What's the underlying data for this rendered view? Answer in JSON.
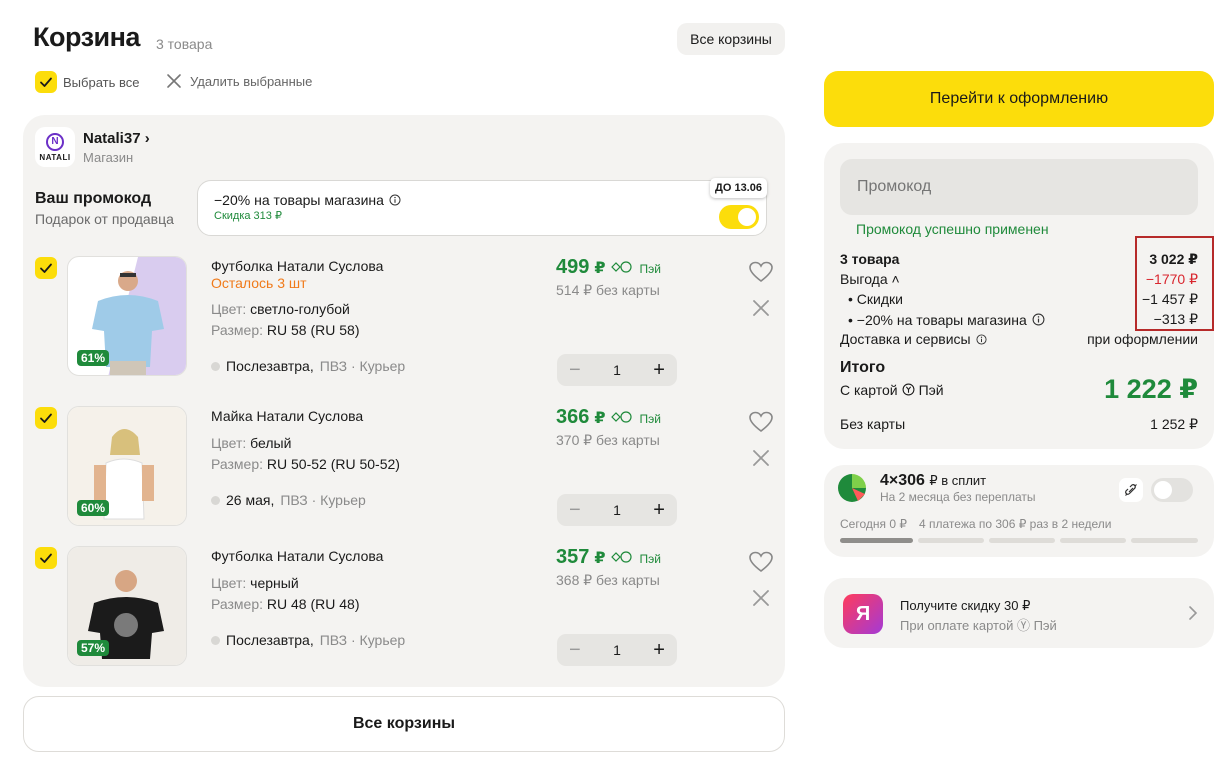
{
  "header": {
    "title": "Корзина",
    "count": "3 товара",
    "all_carts": "Все корзины",
    "select_all": "Выбрать все",
    "delete_selected": "Удалить выбранные"
  },
  "shop": {
    "logo_text": "NATALI",
    "name": "Natali37 ›",
    "type": "Магазин"
  },
  "promo": {
    "title": "Ваш промокод",
    "subtitle": "Подарок от продавца",
    "text": "−20% на товары магазина",
    "discount": "Скидка 313 ₽",
    "until": "ДО 13.06"
  },
  "items": [
    {
      "name": "Футболка Натали Суслова",
      "left": "Осталось 3 шт",
      "color_label": "Цвет:",
      "color": "светло-голубой",
      "size_label": "Размер:",
      "size": "RU 58 (RU 58)",
      "delivery_date": "Послезавтра,",
      "delivery_way": "ПВЗ · Курьер",
      "price": "499",
      "currency": "₽",
      "pay_label": "Пэй",
      "no_card": "514 ₽ без карты",
      "discount": "61%",
      "qty": "1",
      "image_color": "#9fcbe8"
    },
    {
      "name": "Майка Натали Суслова",
      "left": "",
      "color_label": "Цвет:",
      "color": "белый",
      "size_label": "Размер:",
      "size": "RU 50-52 (RU 50-52)",
      "delivery_date": "26 мая,",
      "delivery_way": "ПВЗ · Курьер",
      "price": "366",
      "currency": "₽",
      "pay_label": "Пэй",
      "no_card": "370 ₽ без карты",
      "discount": "60%",
      "qty": "1",
      "image_color": "#f2ede6"
    },
    {
      "name": "Футболка Натали Суслова",
      "left": "",
      "color_label": "Цвет:",
      "color": "черный",
      "size_label": "Размер:",
      "size": "RU 48 (RU 48)",
      "delivery_date": "Послезавтра,",
      "delivery_way": "ПВЗ · Курьер",
      "price": "357",
      "currency": "₽",
      "pay_label": "Пэй",
      "no_card": "368 ₽ без карты",
      "discount": "57%",
      "qty": "1",
      "image_color": "#ece8e3"
    }
  ],
  "bottom": {
    "all_carts": "Все корзины"
  },
  "summary": {
    "checkout": "Перейти к оформлению",
    "promo_placeholder": "Промокод",
    "promo_ok": "Промокод успешно применен",
    "goods_label": "3 товара",
    "goods_value": "3 022 ₽",
    "benefit_label": "Выгода ˄",
    "benefit_value": "−1770 ₽",
    "discounts_label": "• Скидки",
    "discounts_value": "−1 457 ₽",
    "shop_promo_label": "• −20% на товары магазина",
    "shop_promo_value": "−313 ₽",
    "delivery_label": "Доставка и сервисы",
    "delivery_value": "при оформлении",
    "total_title": "Итого",
    "with_card_label": "С картой",
    "with_card_brand": "Пэй",
    "with_card_value": "1 222 ₽",
    "without_card_label": "Без карты",
    "without_card_value": "1 252 ₽"
  },
  "split": {
    "title": "4×306",
    "title_suffix": "₽ в сплит",
    "subtitle": "На 2 месяца без переплаты",
    "today": "Сегодня 0 ₽",
    "plan": "4 платежа по 306 ₽ раз в 2 недели"
  },
  "yacard": {
    "logo": "Я",
    "title": "Получите скидку 30 ₽",
    "subtitle": "При оплате картой Ⓨ Пэй"
  },
  "colors": {
    "accent": "#fcdd0b",
    "green": "#1f8a3b",
    "red": "#d9262e",
    "orange": "#f07a1a"
  }
}
